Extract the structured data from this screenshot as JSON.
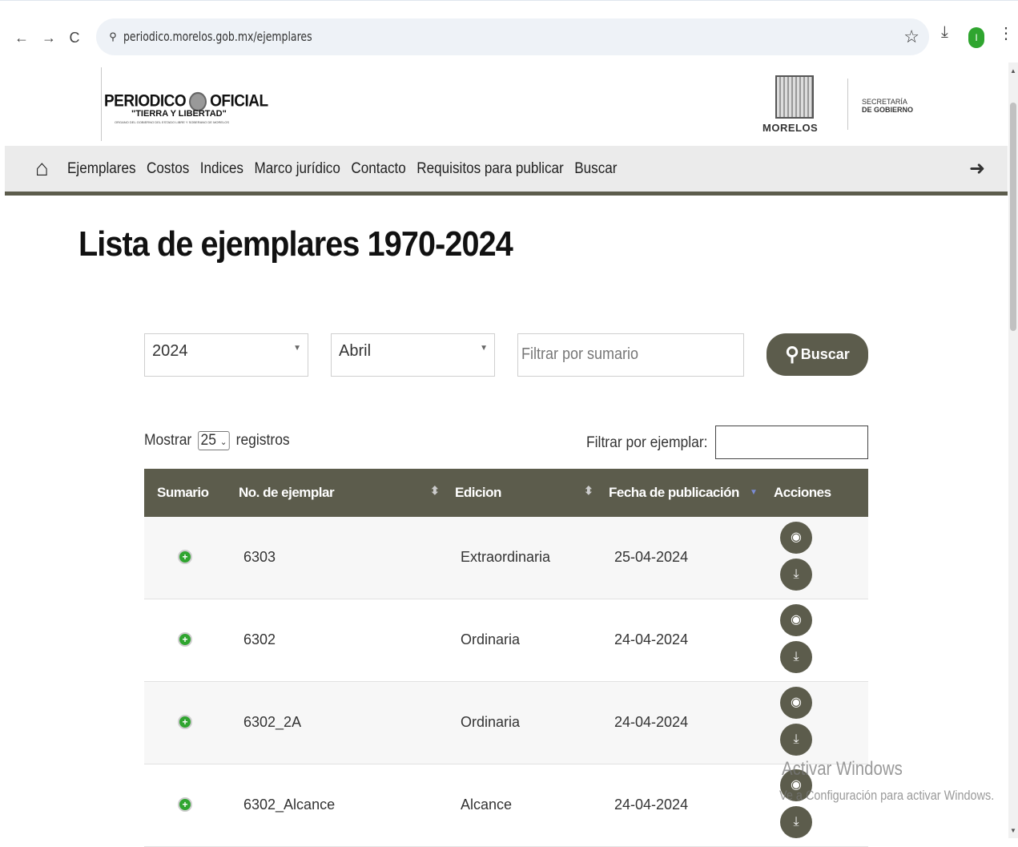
{
  "browser": {
    "url": "periodico.morelos.gob.mx/ejemplares",
    "back_icon": "←",
    "forward_icon": "→",
    "reload_icon": "C",
    "site_icon": "⚲",
    "bookmark_icon": "☆",
    "download_icon": "⤓",
    "profile_initial": "I",
    "menu_icon": "⋮"
  },
  "header": {
    "logo_left": "PERIODICO",
    "logo_right": "OFICIAL",
    "logo_sub": "\"TIERRA Y LIBERTAD\"",
    "logo_tiny": "ORGANO DEL GOBIERNO DEL ESTADO LIBRE Y SOBERANO DE MORELOS",
    "state_name": "MORELOS",
    "secretaria_line1": "SECRETARÍA",
    "secretaria_line2": "DE GOBIERNO"
  },
  "nav": {
    "items": [
      "Ejemplares",
      "Costos",
      "Indices",
      "Marco jurídico",
      "Contacto",
      "Requisitos para publicar",
      "Buscar"
    ]
  },
  "page": {
    "title": "Lista de ejemplares 1970-2024"
  },
  "filters": {
    "year": "2024",
    "month": "Abril",
    "sumario_placeholder": "Filtrar por sumario",
    "search_label": "Buscar"
  },
  "table_controls": {
    "show_prefix": "Mostrar",
    "show_value": "25",
    "show_suffix": "registros",
    "filter_label": "Filtrar por ejemplar:"
  },
  "table": {
    "headers": [
      "Sumario",
      "No. de ejemplar",
      "Edicion",
      "Fecha de publicación",
      "Acciones"
    ],
    "rows": [
      {
        "numero": "6303",
        "edicion": "Extraordinaria",
        "fecha": "25-04-2024"
      },
      {
        "numero": "6302",
        "edicion": "Ordinaria",
        "fecha": "24-04-2024"
      },
      {
        "numero": "6302_2A",
        "edicion": "Ordinaria",
        "fecha": "24-04-2024"
      },
      {
        "numero": "6302_Alcance",
        "edicion": "Alcance",
        "fecha": "24-04-2024"
      }
    ]
  },
  "watermark": {
    "line1": "Activar Windows",
    "line2": "Ve a Configuración para activar Windows."
  },
  "colors": {
    "accent": "#5c5c4c",
    "plus_green": "#2fa52f"
  }
}
